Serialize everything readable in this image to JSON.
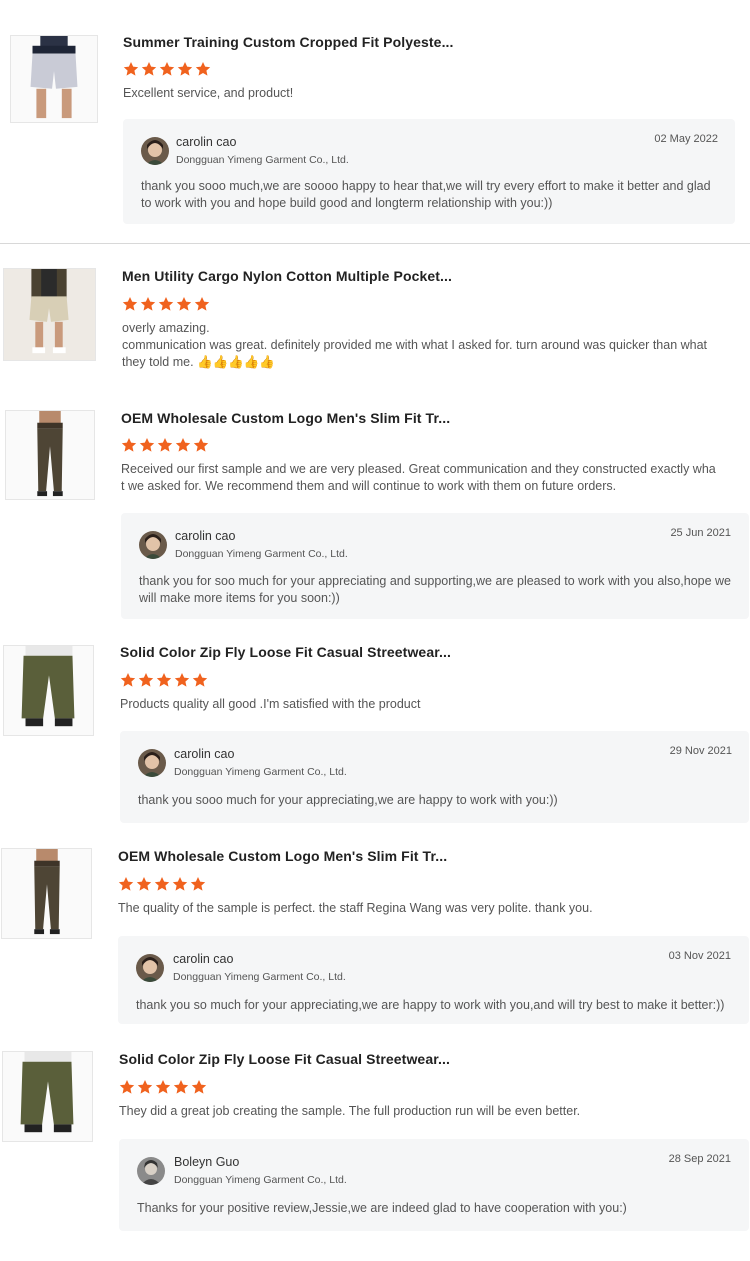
{
  "reviews": [
    {
      "title": "Summer Training Custom Cropped Fit Polyeste...",
      "rating": 5,
      "text": "Excellent service, and product!",
      "reply": {
        "name": "carolin cao",
        "company": "Dongguan Yimeng Garment Co., Ltd.",
        "date": "02 May 2022",
        "text": "thank you sooo much,we are soooo happy to hear that,we will try every effort to make it better and glad to work with you and hope build good and longterm relationship with you:))"
      }
    },
    {
      "title": "Men Utility Cargo Nylon Cotton Multiple Pocket...",
      "rating": 5,
      "text": "overly amazing.\ncommunication was great. definitely provided me with what I asked for. turn around was quicker than what they told me. 👍👍👍👍👍"
    },
    {
      "title": "OEM Wholesale Custom Logo Men's Slim Fit Tr...",
      "rating": 5,
      "text": "Received our first sample and we are very pleased. Great communication and they constructed exactly wha t we asked for. We recommend them and will continue to work with them on future orders.",
      "reply": {
        "name": "carolin cao",
        "company": "Dongguan Yimeng Garment Co., Ltd.",
        "date": "25 Jun 2021",
        "text": "thank you for soo much for your appreciating and supporting,we are pleased to work with you also,hope we will make more items for you soon:))"
      }
    },
    {
      "title": "Solid Color Zip Fly Loose Fit Casual Streetwear...",
      "rating": 5,
      "text": "Products quality all good .I'm satisfied with the product",
      "reply": {
        "name": "carolin cao",
        "company": "Dongguan Yimeng Garment Co., Ltd.",
        "date": "29 Nov 2021",
        "text": "thank you sooo much for your appreciating,we are happy to work with you:))"
      }
    },
    {
      "title": "OEM Wholesale Custom Logo Men's Slim Fit Tr...",
      "rating": 5,
      "text": "The quality of the sample is perfect. the staff Regina Wang was very polite. thank you.",
      "reply": {
        "name": "carolin cao",
        "company": "Dongguan Yimeng Garment Co., Ltd.",
        "date": "03 Nov 2021",
        "text": "thank you so much for your appreciating,we are happy to work with you,and will try best to make it better:))"
      }
    },
    {
      "title": "Solid Color Zip Fly Loose Fit Casual Streetwear...",
      "rating": 5,
      "text": "They did a great job creating the sample. The full production run will be even better.",
      "reply": {
        "name": "Boleyn Guo",
        "company": "Dongguan Yimeng Garment Co., Ltd.",
        "date": "28 Sep 2021",
        "text": "Thanks for your positive review,Jessie,we are indeed glad to have cooperation with you:)"
      }
    }
  ],
  "colors": {
    "star": "#f0621e",
    "reply_bg": "#f5f6f7"
  },
  "icons": {
    "star": "star-icon",
    "product": "product-thumbnail"
  }
}
